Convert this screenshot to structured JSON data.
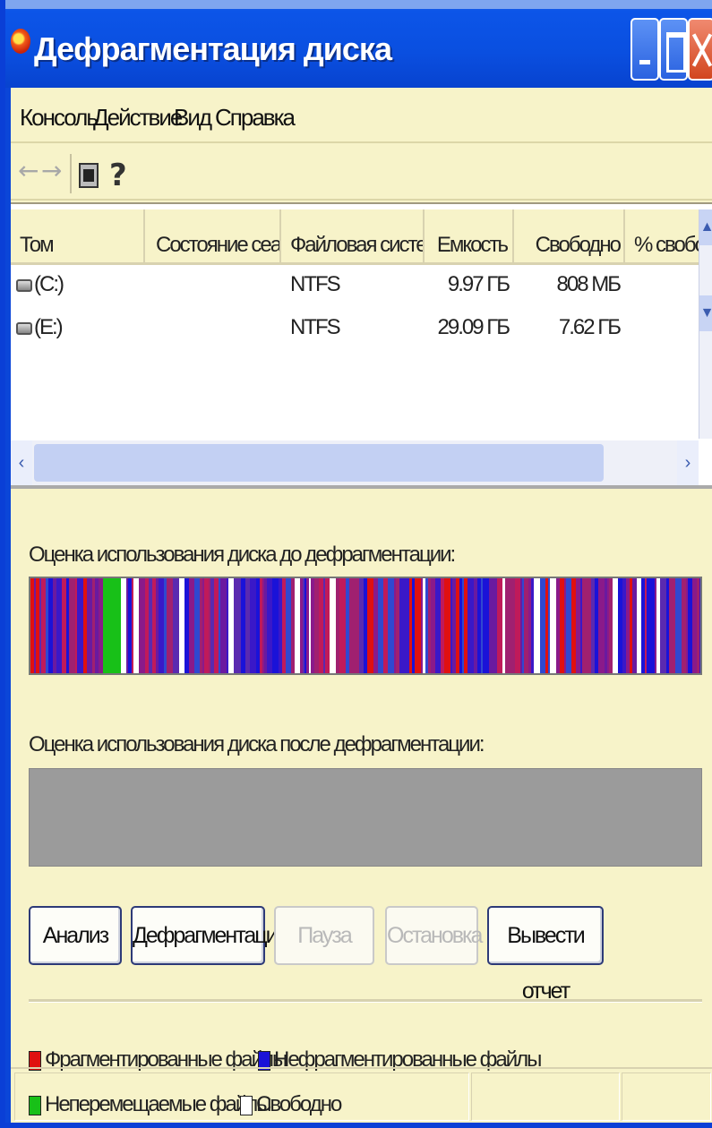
{
  "window": {
    "title": "Дефрагментация диска"
  },
  "menu": {
    "items": [
      "Консоль",
      "Действие",
      "Вид",
      "Справка"
    ]
  },
  "toolbar": {
    "back_icon": "arrow-left-icon",
    "forward_icon": "arrow-right-icon",
    "console_icon": "console-tree-icon",
    "help_icon": "help-icon"
  },
  "volumes": {
    "columns": [
      "Том",
      "Состояние сеанса",
      "Файловая система",
      "Емкость",
      "Свободно",
      "% свобо"
    ],
    "rows": [
      {
        "volume": "(C:)",
        "status": "",
        "fs": "NTFS",
        "capacity": "9.97 ГБ",
        "free": "808 МБ",
        "pct": ""
      },
      {
        "volume": "(E:)",
        "status": "",
        "fs": "NTFS",
        "capacity": "29.09 ГБ",
        "free": "7.62 ГБ",
        "pct": ""
      }
    ]
  },
  "analysis": {
    "before_label": "Оценка использования диска до дефрагментации:",
    "after_label": "Оценка использования диска после дефрагментации:"
  },
  "buttons": {
    "analyze": "Анализ",
    "defrag": "Дефрагментация",
    "pause": "Пауза",
    "stop": "Остановка",
    "report": "Вывести отчет"
  },
  "legend": {
    "fragmented": "Фрагментированные файлы",
    "contiguous": "Нефрагментированные файлы",
    "unmovable": "Неперемещаемые файлы",
    "free": "Свободно",
    "colors": {
      "fragmented": "#e01010",
      "contiguous": "#1a12d8",
      "unmovable": "#18c018",
      "free": "#ffffff"
    }
  }
}
